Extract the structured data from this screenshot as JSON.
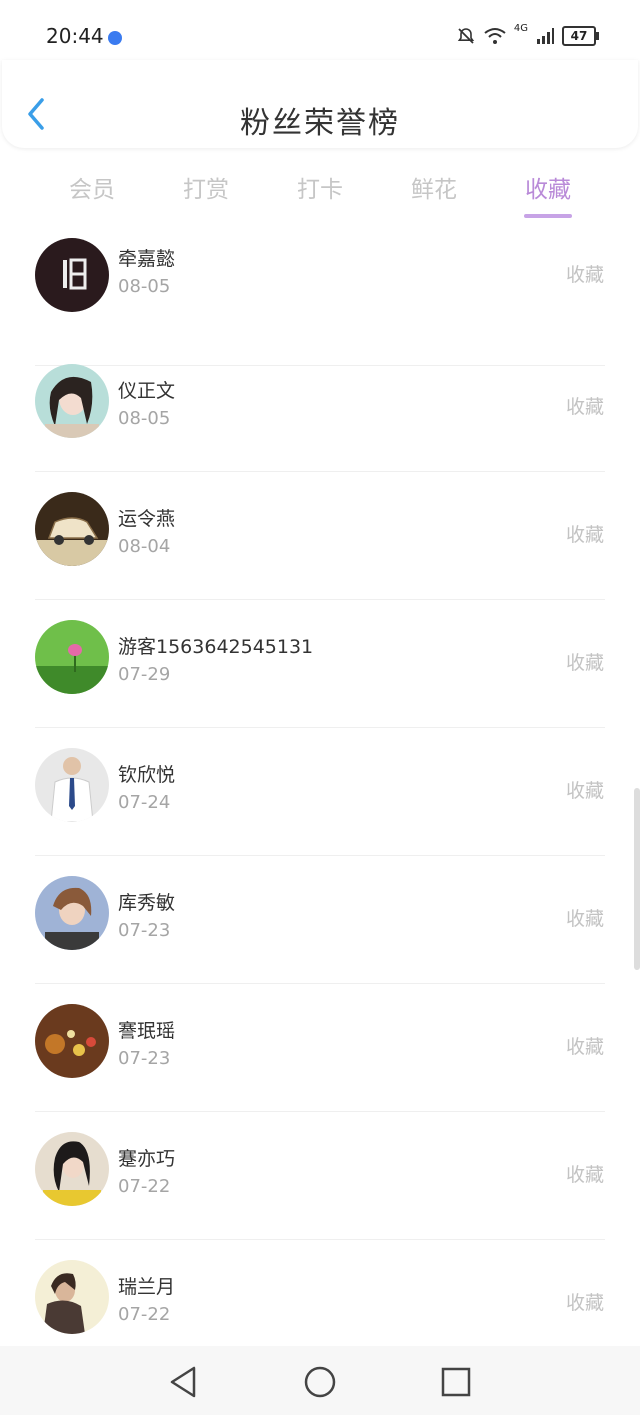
{
  "status_bar": {
    "time": "20:44",
    "network_label": "4G",
    "battery_level": "47"
  },
  "header": {
    "title": "粉丝荣誉榜"
  },
  "tabs": [
    {
      "label": "会员"
    },
    {
      "label": "打赏"
    },
    {
      "label": "打卡"
    },
    {
      "label": "鲜花"
    },
    {
      "label": "收藏"
    }
  ],
  "active_tab": 4,
  "rows": [
    {
      "name": "牵嘉懿",
      "date": "08-05",
      "action": "收藏"
    },
    {
      "name": "仪正文",
      "date": "08-05",
      "action": "收藏"
    },
    {
      "name": "运令燕",
      "date": "08-04",
      "action": "收藏"
    },
    {
      "name": "游客1563642545131",
      "date": "07-29",
      "action": "收藏"
    },
    {
      "name": "钦欣悦",
      "date": "07-24",
      "action": "收藏"
    },
    {
      "name": "库秀敏",
      "date": "07-23",
      "action": "收藏"
    },
    {
      "name": "謇珉瑶",
      "date": "07-23",
      "action": "收藏"
    },
    {
      "name": "蹇亦巧",
      "date": "07-22",
      "action": "收藏"
    },
    {
      "name": "瑞兰月",
      "date": "07-22",
      "action": "收藏"
    }
  ],
  "colors": {
    "accent": "#b98ad8",
    "back_arrow": "#3a9ee8",
    "inactive_tab": "#c6c6c6",
    "date_text": "#a5a5a5"
  }
}
